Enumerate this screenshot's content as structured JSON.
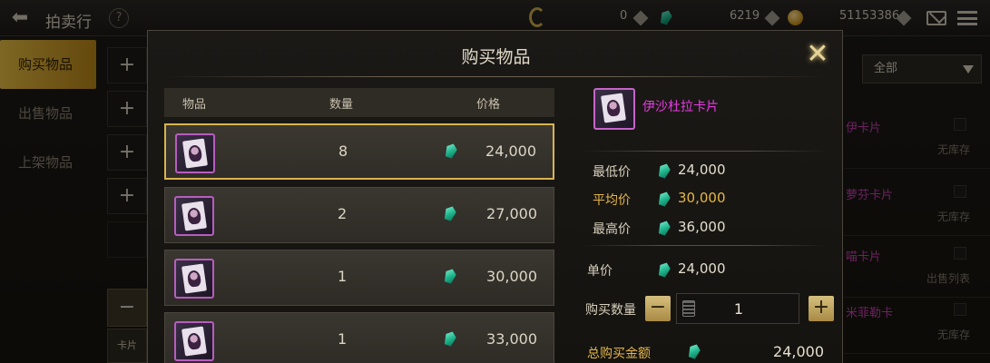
{
  "topbar": {
    "title": "拍卖行",
    "help": "?",
    "currency1": "0",
    "currency2": "6219",
    "currency3": "51153386"
  },
  "nav": {
    "items": [
      {
        "label": "购买物品",
        "active": true
      },
      {
        "label": "出售物品",
        "active": false
      },
      {
        "label": "上架物品",
        "active": false
      }
    ],
    "card_tab": "卡片"
  },
  "background_list": {
    "filter": "全部",
    "rows": [
      {
        "name": "伊卡片",
        "sub": "无库存"
      },
      {
        "name": "萝芬卡片",
        "sub": "无库存"
      },
      {
        "name": "喵卡片",
        "sub": "出售列表"
      },
      {
        "name": "米菲勒卡",
        "sub": "无库存"
      }
    ]
  },
  "modal": {
    "title": "购买物品",
    "columns": {
      "item": "物品",
      "qty": "数量",
      "price": "价格"
    },
    "rows": [
      {
        "qty": "8",
        "price": "24,000"
      },
      {
        "qty": "2",
        "price": "27,000"
      },
      {
        "qty": "1",
        "price": "30,000"
      },
      {
        "qty": "1",
        "price": "33,000"
      }
    ],
    "item_name": "伊沙杜拉卡片",
    "stats": {
      "min_label": "最低价",
      "min_value": "24,000",
      "avg_label": "平均价",
      "avg_value": "30,000",
      "max_label": "最高价",
      "max_value": "36,000"
    },
    "unit_label": "单价",
    "unit_value": "24,000",
    "buy_qty_label": "购买数量",
    "buy_qty_value": "1",
    "total_label": "总购买金额",
    "total_value": "24,000"
  },
  "colors": {
    "accent_gold": "#d7b54c",
    "item_purple": "#e73be3",
    "gem_teal": "#1eb38a"
  }
}
